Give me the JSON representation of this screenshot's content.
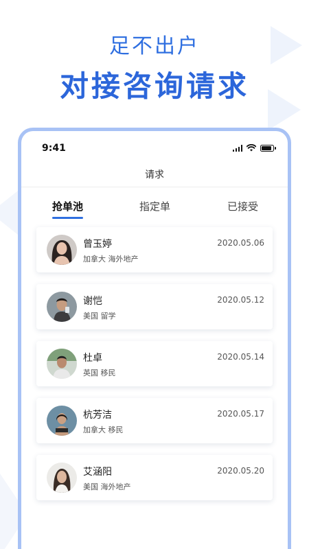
{
  "hero": {
    "subtitle": "足不出户",
    "title": "对接咨询请求"
  },
  "status_bar": {
    "time": "9:41",
    "icons": [
      "signal-icon",
      "wifi-icon",
      "battery-icon"
    ]
  },
  "nav": {
    "title": "请求"
  },
  "tabs": [
    {
      "label": "抢单池",
      "active": true
    },
    {
      "label": "指定单",
      "active": false
    },
    {
      "label": "已接受",
      "active": false
    }
  ],
  "requests": [
    {
      "name": "曾玉婷",
      "country": "加拿大",
      "category": "海外地产",
      "date": "2020.05.06",
      "avatar": "avatar-woman-1"
    },
    {
      "name": "谢恺",
      "country": "美国",
      "category": "留学",
      "date": "2020.05.12",
      "avatar": "avatar-man-1"
    },
    {
      "name": "杜卓",
      "country": "英国",
      "category": "移民",
      "date": "2020.05.14",
      "avatar": "avatar-man-2"
    },
    {
      "name": "杭芳洁",
      "country": "加拿大",
      "category": "移民",
      "date": "2020.05.17",
      "avatar": "avatar-woman-2"
    },
    {
      "name": "艾涵阳",
      "country": "美国",
      "category": "海外地产",
      "date": "2020.05.20",
      "avatar": "avatar-woman-3"
    }
  ],
  "colors": {
    "accent": "#2f6fe0",
    "frame": "#a8c2f5",
    "background": "#ffffff"
  }
}
